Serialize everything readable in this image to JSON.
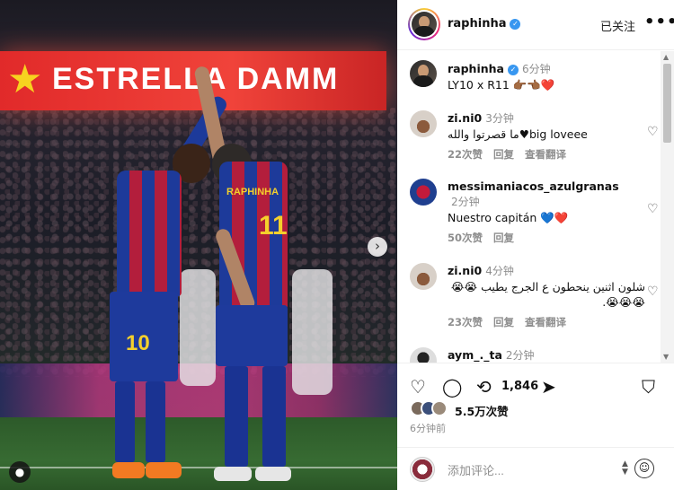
{
  "photo": {
    "banner_text": "ESTRELLA DAMM",
    "player_front_number": "10",
    "player_back_number": "11",
    "player_back_name": "RAPHINHA",
    "next_icon": "chevron-right-icon",
    "user_tag_icon": "user-icon"
  },
  "header": {
    "username": "raphinha",
    "follow_label": "已关注",
    "more_label": "•••"
  },
  "caption": {
    "username": "raphinha",
    "time": "6分钟",
    "text": "LY10 x R11 👉🏾👈🏾❤️"
  },
  "comments": [
    {
      "username": "zi.ni0",
      "time": "3分钟",
      "text": "ما قصرتوا والله♥big loveee",
      "likes": "22次赞",
      "reply": "回复",
      "translate": "查看翻译"
    },
    {
      "username": "messimaniacos_azulgranas",
      "time": "2分钟",
      "text": "Nuestro capitán 💙❤️",
      "likes": "50次赞",
      "reply": "回复"
    },
    {
      "username": "zi.ni0",
      "time": "4分钟",
      "text": "شلون اثنين ينحطون ع الجرج يطيب 😭😭😭😭😭.",
      "likes": "23次赞",
      "reply": "回复",
      "translate": "查看翻译"
    },
    {
      "username": "aym_._ta",
      "time": "2分钟"
    }
  ],
  "actions": {
    "repost_count": "1,846",
    "likes_text": "5.5万次赞",
    "time_ago": "6分钟前"
  },
  "composer": {
    "placeholder": "添加评论..."
  },
  "colors": {
    "accent": "#3897f0",
    "banner": "#e12a2a",
    "barca_blue": "#1d3a9a",
    "barca_red": "#b31e3c"
  }
}
